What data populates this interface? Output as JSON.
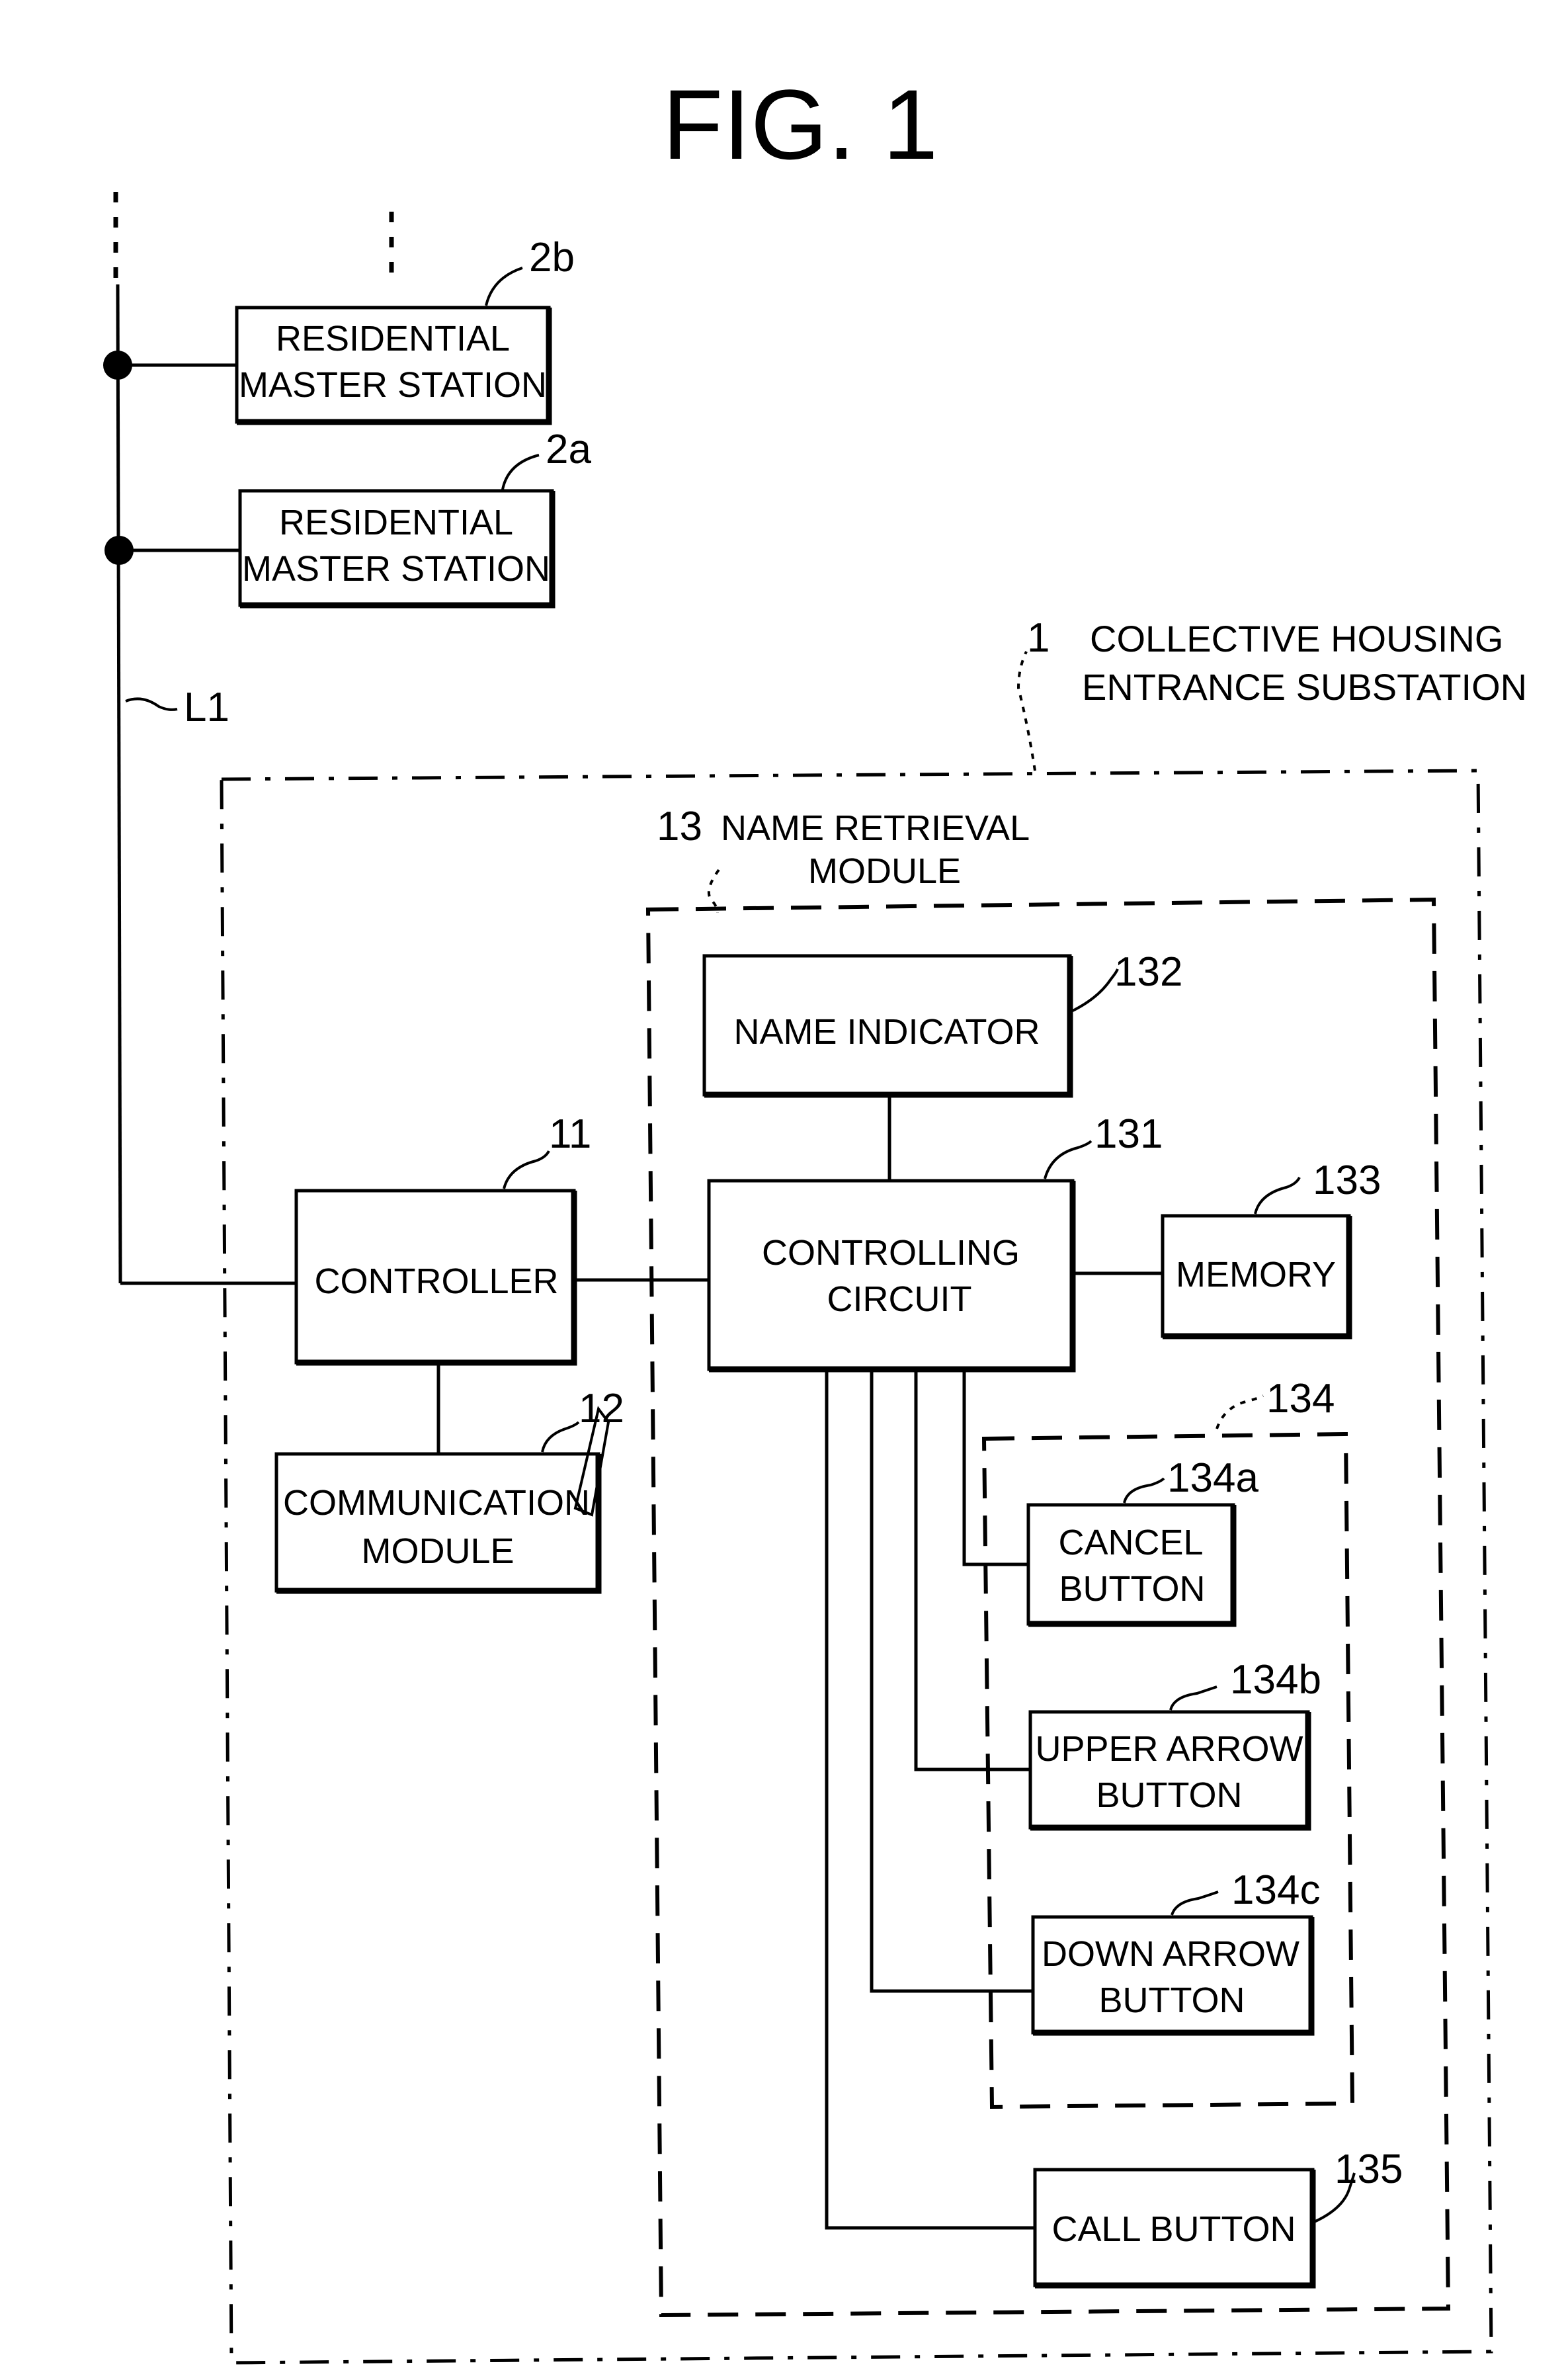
{
  "figure": {
    "title": "FIG. 1"
  },
  "bus": {
    "label": "L1"
  },
  "blocks": {
    "master_2b": {
      "ref": "2b",
      "lines": [
        "RESIDENTIAL",
        "MASTER STATION"
      ]
    },
    "master_2a": {
      "ref": "2a",
      "lines": [
        "RESIDENTIAL",
        "MASTER STATION"
      ]
    },
    "substation": {
      "ref": "1",
      "lines": [
        "COLLECTIVE HOUSING",
        "ENTRANCE SUBSTATION"
      ]
    },
    "name_retrieval": {
      "ref": "13",
      "lines": [
        "NAME RETRIEVAL",
        "MODULE"
      ]
    },
    "controller": {
      "ref": "11",
      "lines": [
        "CONTROLLER"
      ]
    },
    "communication": {
      "ref": "12",
      "lines": [
        "COMMUNICATION",
        "MODULE"
      ]
    },
    "name_indicator": {
      "ref": "132",
      "lines": [
        "NAME INDICATOR"
      ]
    },
    "controlling_circuit": {
      "ref": "131",
      "lines": [
        "CONTROLLING",
        "CIRCUIT"
      ]
    },
    "memory": {
      "ref": "133",
      "lines": [
        "MEMORY"
      ]
    },
    "button_group": {
      "ref": "134"
    },
    "cancel_button": {
      "ref": "134a",
      "lines": [
        "CANCEL",
        "BUTTON"
      ]
    },
    "upper_arrow_button": {
      "ref": "134b",
      "lines": [
        "UPPER ARROW",
        "BUTTON"
      ]
    },
    "down_arrow_button": {
      "ref": "134c",
      "lines": [
        "DOWN ARROW",
        "BUTTON"
      ]
    },
    "call_button": {
      "ref": "135",
      "lines": [
        "CALL BUTTON"
      ]
    }
  }
}
